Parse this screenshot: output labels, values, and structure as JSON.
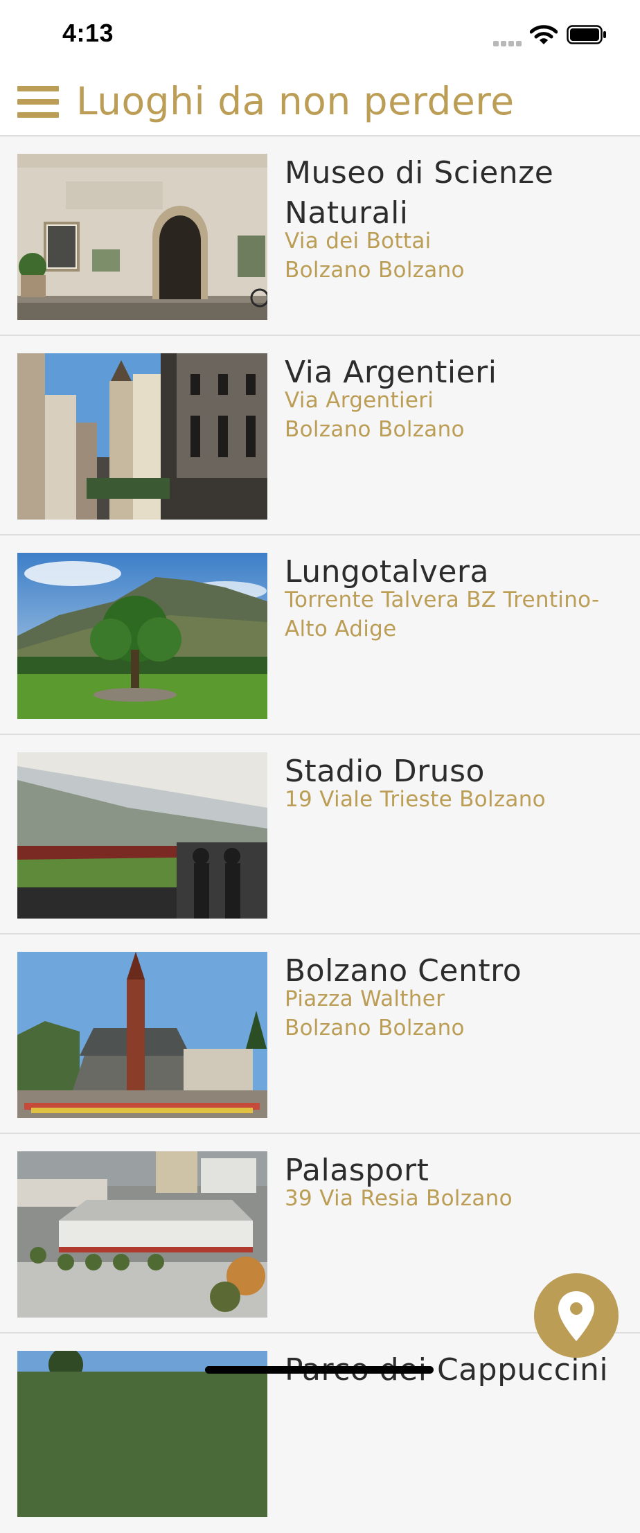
{
  "status_bar": {
    "time": "4:13"
  },
  "header": {
    "title": "Luoghi da non perdere"
  },
  "places": [
    {
      "name": "Museo di Scienze Naturali",
      "address_lines": [
        "Via dei Bottai",
        "Bolzano Bolzano"
      ]
    },
    {
      "name": "Via Argentieri",
      "address_lines": [
        "Via Argentieri",
        "Bolzano Bolzano"
      ]
    },
    {
      "name": "Lungotalvera",
      "address_lines": [
        "Torrente Talvera BZ Trentino-Alto Adige"
      ]
    },
    {
      "name": "Stadio Druso",
      "address_lines": [
        "19 Viale Trieste Bolzano"
      ]
    },
    {
      "name": "Bolzano Centro",
      "address_lines": [
        "Piazza Walther",
        "Bolzano Bolzano"
      ]
    },
    {
      "name": "Palasport",
      "address_lines": [
        "39 Via Resia Bolzano"
      ]
    },
    {
      "name": "Parco dei Cappuccini",
      "address_lines": []
    }
  ],
  "icons": {
    "menu": "menu-icon",
    "map_pin": "map-pin-icon",
    "wifi": "wifi-icon",
    "battery": "battery-icon"
  },
  "colors": {
    "accent": "#bb9d55",
    "text": "#2c2c2c",
    "background": "#f6f6f6"
  }
}
